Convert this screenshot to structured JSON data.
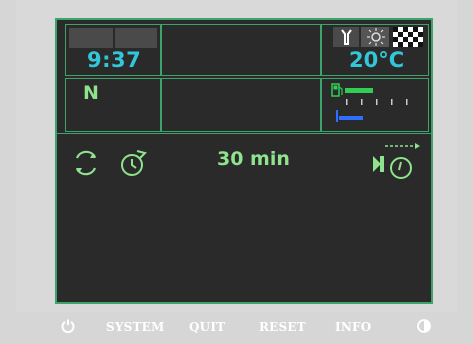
{
  "status": {
    "time": "9:37",
    "temperature": "20°C",
    "gear": "N",
    "timer": "30 min"
  },
  "menu": {
    "system": "SYSTEM",
    "quit": "QUIT",
    "reset": "RESET",
    "info": "INFO"
  },
  "icons": {
    "power": "power-icon",
    "cycle": "cycle-icon",
    "timer_arrow": "timer-arrow-icon",
    "fuel": "fuel-icon",
    "wrench": "wrench-icon",
    "sun": "sun-icon",
    "flag": "checkered-flag-icon",
    "brightness": "brightness-icon",
    "schedule": "schedule-icon"
  },
  "colors": {
    "frame": "#3ea36a",
    "cyan": "#32c6d9",
    "green": "#8fe28e",
    "bar_green": "#33cc55",
    "bar_blue": "#2f6fff",
    "background": "#2a2a2a"
  },
  "levels": {
    "fuel_fraction": 0.35,
    "blue_fraction": 0.28
  }
}
